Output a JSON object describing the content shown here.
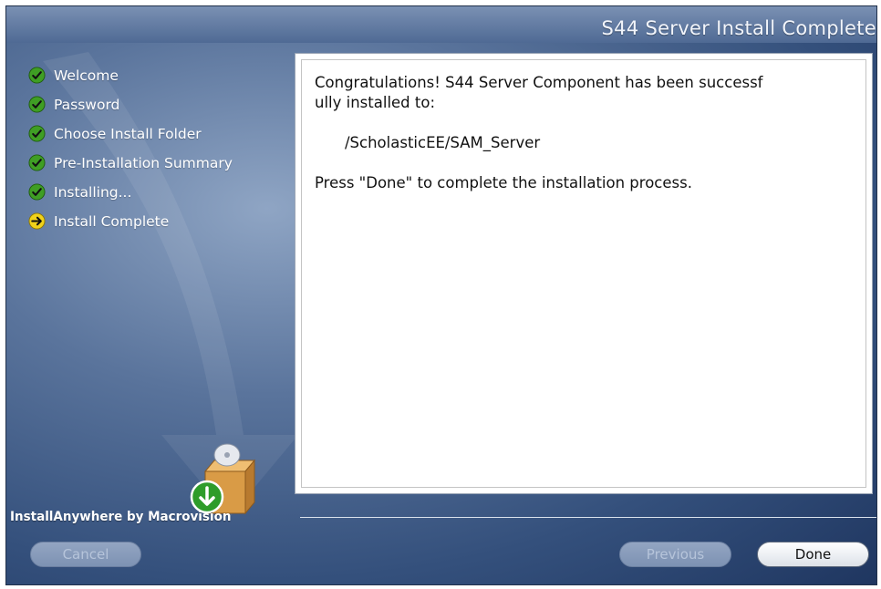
{
  "window": {
    "title": "S44 Server Install Complete"
  },
  "steps": [
    {
      "label": "Welcome",
      "status": "complete",
      "icon": "check-icon"
    },
    {
      "label": "Password",
      "status": "complete",
      "icon": "check-icon"
    },
    {
      "label": "Choose Install Folder",
      "status": "complete",
      "icon": "check-icon"
    },
    {
      "label": "Pre-Installation Summary",
      "status": "complete",
      "icon": "check-icon"
    },
    {
      "label": "Installing...",
      "status": "complete",
      "icon": "check-icon"
    },
    {
      "label": "Install Complete",
      "status": "current",
      "icon": "arrow-right-icon"
    }
  ],
  "content": {
    "line1": "Congratulations! S44 Server Component has been successf",
    "line2": "ully installed to:",
    "path": "/ScholasticEE/SAM_Server",
    "instruction": "Press \"Done\" to complete the installation process."
  },
  "footer": {
    "brand": "InstallAnywhere by Macrovision"
  },
  "buttons": {
    "cancel": "Cancel",
    "previous": "Previous",
    "done": "Done"
  },
  "colors": {
    "complete": "#3f9e24",
    "current": "#f0d21a"
  }
}
